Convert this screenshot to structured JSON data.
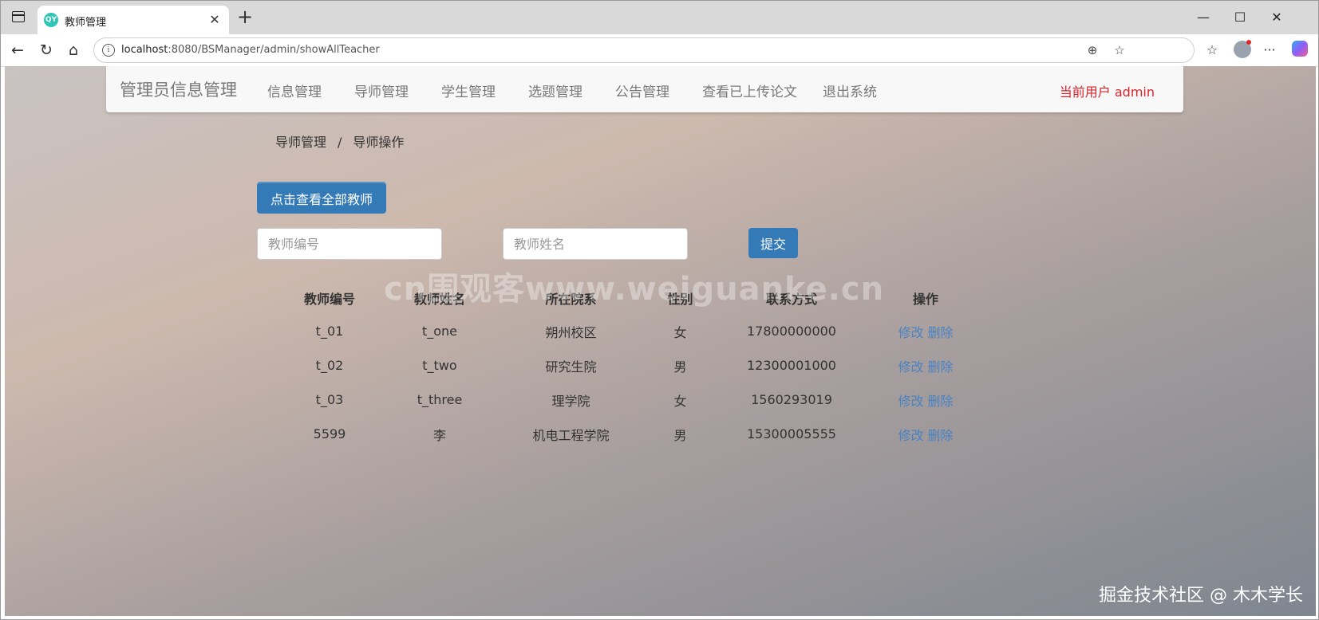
{
  "browser": {
    "tab_title": "教师管理",
    "favicon_text": "QY",
    "url_host": "localhost",
    "url_rest": ":8080/BSManager/admin/showAllTeacher"
  },
  "navbar": {
    "brand": "管理员信息管理",
    "items": [
      "信息管理",
      "导师管理",
      "学生管理",
      "选题管理",
      "公告管理",
      "查看已上传论文",
      "退出系统"
    ],
    "current_user": "当前用户 admin"
  },
  "breadcrumb": {
    "parent": "导师管理",
    "separator": "/",
    "current": "导师操作"
  },
  "actions": {
    "show_all_label": "点击查看全部教师",
    "submit_label": "提交"
  },
  "search": {
    "id_placeholder": "教师编号",
    "name_placeholder": "教师姓名"
  },
  "table": {
    "headers": [
      "教师编号",
      "教师姓名",
      "所在院系",
      "性别",
      "联系方式",
      "操作"
    ],
    "rows": [
      {
        "id": "t_01",
        "name": "t_one",
        "dept": "朔州校区",
        "sex": "女",
        "phone": "17800000000"
      },
      {
        "id": "t_02",
        "name": "t_two",
        "dept": "研究生院",
        "sex": "男",
        "phone": "12300001000"
      },
      {
        "id": "t_03",
        "name": "t_three",
        "dept": "理学院",
        "sex": "女",
        "phone": "1560293019"
      },
      {
        "id": "5599",
        "name": "李",
        "dept": "机电工程学院",
        "sex": "男",
        "phone": "15300005555"
      }
    ],
    "edit_label": "修改",
    "delete_label": "删除"
  },
  "overlay": {
    "watermark": "cn围观客www.weiguanke.cn",
    "corner": "掘金技术社区 @ 木木学长"
  },
  "colors": {
    "primary_button": "#337ab7",
    "current_user": "#d9232d",
    "link": "#4a82c2"
  }
}
